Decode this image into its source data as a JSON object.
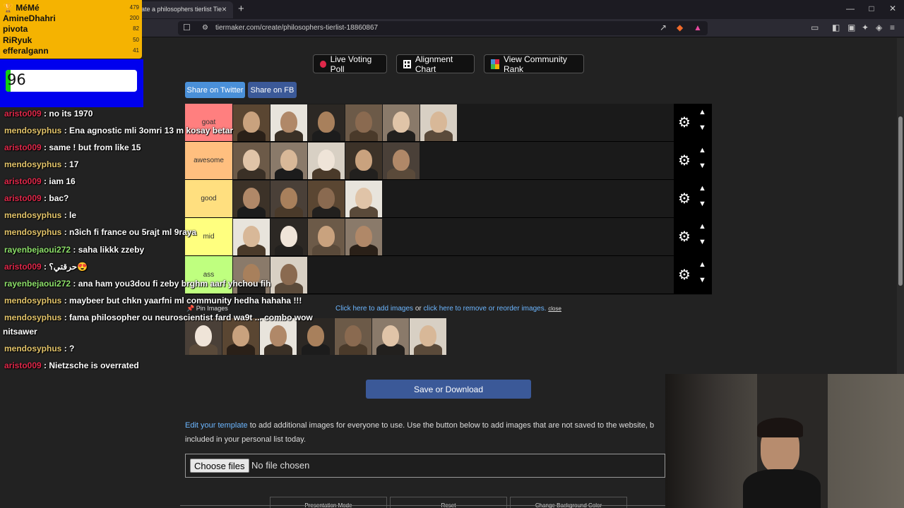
{
  "browser": {
    "tab_title": "ate a philosophers tierlist Tie",
    "tab_close": "×",
    "new_tab": "+",
    "url": "tiermaker.com/create/philosophers-tierlist-18860867",
    "win_min": "—",
    "win_max": "□",
    "win_close": "✕"
  },
  "toolbar": {
    "live_voting": "Live Voting Poll",
    "alignment_chart": "Alignment Chart",
    "community_rank": "View Community Rank"
  },
  "share": {
    "twitter": "Share on Twitter",
    "fb": "Share on FB"
  },
  "tiers": [
    {
      "label": "goat",
      "color": "#ff7f7f",
      "count": 6
    },
    {
      "label": "awesome",
      "color": "#ffbf7f",
      "count": 5
    },
    {
      "label": "good",
      "color": "#ffdf7f",
      "count": 4
    },
    {
      "label": "mid",
      "color": "#ffff7f",
      "count": 4
    },
    {
      "label": "ass",
      "color": "#bfff7f",
      "count": 2
    }
  ],
  "pool": {
    "pin_label": "📌 Pin Images",
    "add_link": "Click here to add images",
    "or": " or ",
    "remove_link": "click here to remove or reorder images.",
    "close": "close",
    "count": 7
  },
  "save_label": "Save or Download",
  "edit": {
    "link": "Edit your template",
    "text": " to add additional images for everyone to use. Use the button below to add images that are not saved to the website, b included in your personal list today."
  },
  "file": {
    "choose": "Choose files",
    "none": "No file chosen"
  },
  "bottom_buttons": {
    "presentation": "Presentation Mode",
    "reset": "Reset",
    "bg": "Change Background Color"
  },
  "leaderboard": [
    {
      "name": "🏆 MéMé",
      "score": "479"
    },
    {
      "name": "AmineDhahri",
      "score": "200"
    },
    {
      "name": "pivota",
      "score": "82"
    },
    {
      "name": "RiRyuk",
      "score": "50"
    },
    {
      "name": "efferalgann",
      "score": "41"
    }
  ],
  "timer": {
    "value": "96",
    "fraction": 0.04
  },
  "chat": [
    {
      "user": "aristo009",
      "msg": " : no its 1970"
    },
    {
      "user": "mendosyphus",
      "msg": " : Ena agnostic mli 3omri 13 m kosay betar"
    },
    {
      "user": "aristo009",
      "msg": " : same ! but from like 15"
    },
    {
      "user": "mendosyphus",
      "msg": " : 17"
    },
    {
      "user": "aristo009",
      "msg": " : iam 16"
    },
    {
      "user": "aristo009",
      "msg": " : bac?"
    },
    {
      "user": "mendosyphus",
      "msg": " : le"
    },
    {
      "user": "mendosyphus",
      "msg": " : n3ich fi france ou 5rajt ml 9raya"
    },
    {
      "user": "rayenbejaoui272",
      "msg": " : saha likkk zzeby"
    },
    {
      "user": "aristo009",
      "msg": " : حرقتي؟😍"
    },
    {
      "user": "rayenbejaoui272",
      "msg": " : ana ham you3dou fi zeby brghm aarf yhchou fih"
    },
    {
      "user": "mendosyphus",
      "msg": " : maybeer but chkn yaarfni ml community hedha hahaha !!!"
    },
    {
      "user": "mendosyphus",
      "msg": " : fama philosopher ou neuroscientist fard wa9t ... combo wow"
    },
    {
      "user": "",
      "msg": "nitsawer"
    },
    {
      "user": "mendosyphus",
      "msg": " : ?"
    },
    {
      "user": "aristo009",
      "msg": " : Nietzsche is overrated"
    }
  ]
}
